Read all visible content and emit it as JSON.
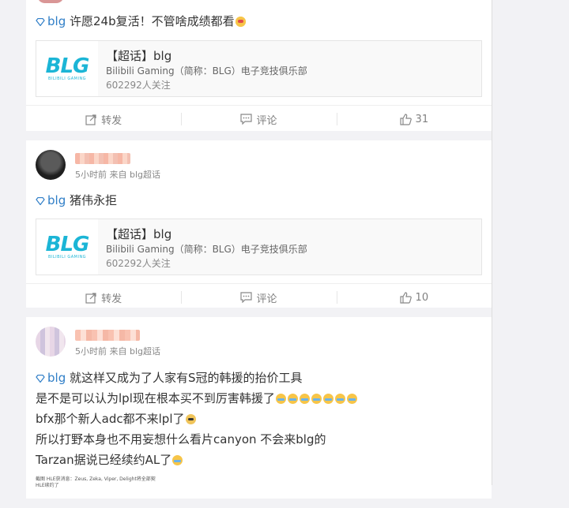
{
  "posts": [
    {
      "topic_tag": "blg",
      "text": "许愿24b复活！不管啥成绩都看",
      "topic_card": {
        "title": "【超话】blg",
        "desc": "Bilibili Gaming（简称：BLG）电子竞技俱乐部",
        "fans": "602292人关注",
        "logo_text": "BLG",
        "logo_sub": "BILIBILI GAMING"
      },
      "actions": {
        "repost": "转发",
        "comment": "评论",
        "like": "31"
      }
    },
    {
      "meta": "5小时前 来自 blg超话",
      "topic_tag": "blg",
      "text": "猪伟永拒",
      "topic_card": {
        "title": "【超话】blg",
        "desc": "Bilibili Gaming（简称：BLG）电子竞技俱乐部",
        "fans": "602292人关注",
        "logo_text": "BLG",
        "logo_sub": "BILIBILI GAMING"
      },
      "actions": {
        "repost": "转发",
        "comment": "评论",
        "like": "10"
      }
    },
    {
      "meta": "5小时前 来自 blg超话",
      "topic_tag": "blg",
      "lines": [
        "就这样又成为了人家有S冠的韩援的抬价工具",
        "是不是可以认为lpl现在根本买不到厉害韩援了",
        "bfx那个新人adc都不来lpl了",
        "所以打野本身也不用妄想什么看片canyon 不会来blg的",
        "Tarzan据说已经续约AL了"
      ],
      "image_snippet": {
        "line1": "截图 HLE获消息：Zeus, Zeka, Viper, Delight将全部契",
        "line2": "HLE续约了"
      }
    }
  ]
}
